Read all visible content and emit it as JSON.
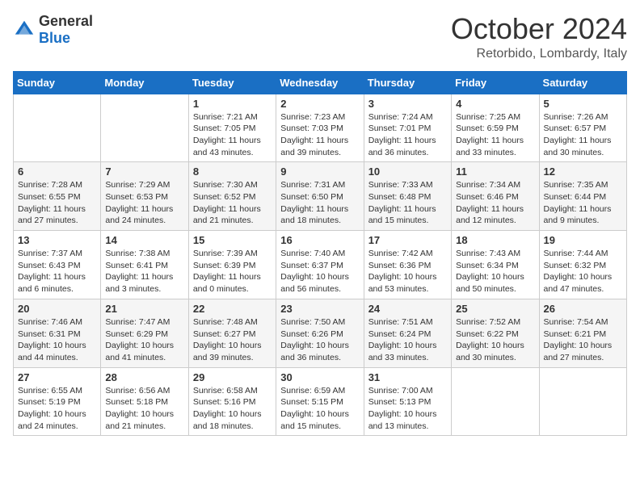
{
  "header": {
    "logo_general": "General",
    "logo_blue": "Blue",
    "title": "October 2024",
    "subtitle": "Retorbido, Lombardy, Italy"
  },
  "days_of_week": [
    "Sunday",
    "Monday",
    "Tuesday",
    "Wednesday",
    "Thursday",
    "Friday",
    "Saturday"
  ],
  "weeks": [
    [
      {
        "day": "",
        "info": ""
      },
      {
        "day": "",
        "info": ""
      },
      {
        "day": "1",
        "info": "Sunrise: 7:21 AM\nSunset: 7:05 PM\nDaylight: 11 hours and 43 minutes."
      },
      {
        "day": "2",
        "info": "Sunrise: 7:23 AM\nSunset: 7:03 PM\nDaylight: 11 hours and 39 minutes."
      },
      {
        "day": "3",
        "info": "Sunrise: 7:24 AM\nSunset: 7:01 PM\nDaylight: 11 hours and 36 minutes."
      },
      {
        "day": "4",
        "info": "Sunrise: 7:25 AM\nSunset: 6:59 PM\nDaylight: 11 hours and 33 minutes."
      },
      {
        "day": "5",
        "info": "Sunrise: 7:26 AM\nSunset: 6:57 PM\nDaylight: 11 hours and 30 minutes."
      }
    ],
    [
      {
        "day": "6",
        "info": "Sunrise: 7:28 AM\nSunset: 6:55 PM\nDaylight: 11 hours and 27 minutes."
      },
      {
        "day": "7",
        "info": "Sunrise: 7:29 AM\nSunset: 6:53 PM\nDaylight: 11 hours and 24 minutes."
      },
      {
        "day": "8",
        "info": "Sunrise: 7:30 AM\nSunset: 6:52 PM\nDaylight: 11 hours and 21 minutes."
      },
      {
        "day": "9",
        "info": "Sunrise: 7:31 AM\nSunset: 6:50 PM\nDaylight: 11 hours and 18 minutes."
      },
      {
        "day": "10",
        "info": "Sunrise: 7:33 AM\nSunset: 6:48 PM\nDaylight: 11 hours and 15 minutes."
      },
      {
        "day": "11",
        "info": "Sunrise: 7:34 AM\nSunset: 6:46 PM\nDaylight: 11 hours and 12 minutes."
      },
      {
        "day": "12",
        "info": "Sunrise: 7:35 AM\nSunset: 6:44 PM\nDaylight: 11 hours and 9 minutes."
      }
    ],
    [
      {
        "day": "13",
        "info": "Sunrise: 7:37 AM\nSunset: 6:43 PM\nDaylight: 11 hours and 6 minutes."
      },
      {
        "day": "14",
        "info": "Sunrise: 7:38 AM\nSunset: 6:41 PM\nDaylight: 11 hours and 3 minutes."
      },
      {
        "day": "15",
        "info": "Sunrise: 7:39 AM\nSunset: 6:39 PM\nDaylight: 11 hours and 0 minutes."
      },
      {
        "day": "16",
        "info": "Sunrise: 7:40 AM\nSunset: 6:37 PM\nDaylight: 10 hours and 56 minutes."
      },
      {
        "day": "17",
        "info": "Sunrise: 7:42 AM\nSunset: 6:36 PM\nDaylight: 10 hours and 53 minutes."
      },
      {
        "day": "18",
        "info": "Sunrise: 7:43 AM\nSunset: 6:34 PM\nDaylight: 10 hours and 50 minutes."
      },
      {
        "day": "19",
        "info": "Sunrise: 7:44 AM\nSunset: 6:32 PM\nDaylight: 10 hours and 47 minutes."
      }
    ],
    [
      {
        "day": "20",
        "info": "Sunrise: 7:46 AM\nSunset: 6:31 PM\nDaylight: 10 hours and 44 minutes."
      },
      {
        "day": "21",
        "info": "Sunrise: 7:47 AM\nSunset: 6:29 PM\nDaylight: 10 hours and 41 minutes."
      },
      {
        "day": "22",
        "info": "Sunrise: 7:48 AM\nSunset: 6:27 PM\nDaylight: 10 hours and 39 minutes."
      },
      {
        "day": "23",
        "info": "Sunrise: 7:50 AM\nSunset: 6:26 PM\nDaylight: 10 hours and 36 minutes."
      },
      {
        "day": "24",
        "info": "Sunrise: 7:51 AM\nSunset: 6:24 PM\nDaylight: 10 hours and 33 minutes."
      },
      {
        "day": "25",
        "info": "Sunrise: 7:52 AM\nSunset: 6:22 PM\nDaylight: 10 hours and 30 minutes."
      },
      {
        "day": "26",
        "info": "Sunrise: 7:54 AM\nSunset: 6:21 PM\nDaylight: 10 hours and 27 minutes."
      }
    ],
    [
      {
        "day": "27",
        "info": "Sunrise: 6:55 AM\nSunset: 5:19 PM\nDaylight: 10 hours and 24 minutes."
      },
      {
        "day": "28",
        "info": "Sunrise: 6:56 AM\nSunset: 5:18 PM\nDaylight: 10 hours and 21 minutes."
      },
      {
        "day": "29",
        "info": "Sunrise: 6:58 AM\nSunset: 5:16 PM\nDaylight: 10 hours and 18 minutes."
      },
      {
        "day": "30",
        "info": "Sunrise: 6:59 AM\nSunset: 5:15 PM\nDaylight: 10 hours and 15 minutes."
      },
      {
        "day": "31",
        "info": "Sunrise: 7:00 AM\nSunset: 5:13 PM\nDaylight: 10 hours and 13 minutes."
      },
      {
        "day": "",
        "info": ""
      },
      {
        "day": "",
        "info": ""
      }
    ]
  ]
}
